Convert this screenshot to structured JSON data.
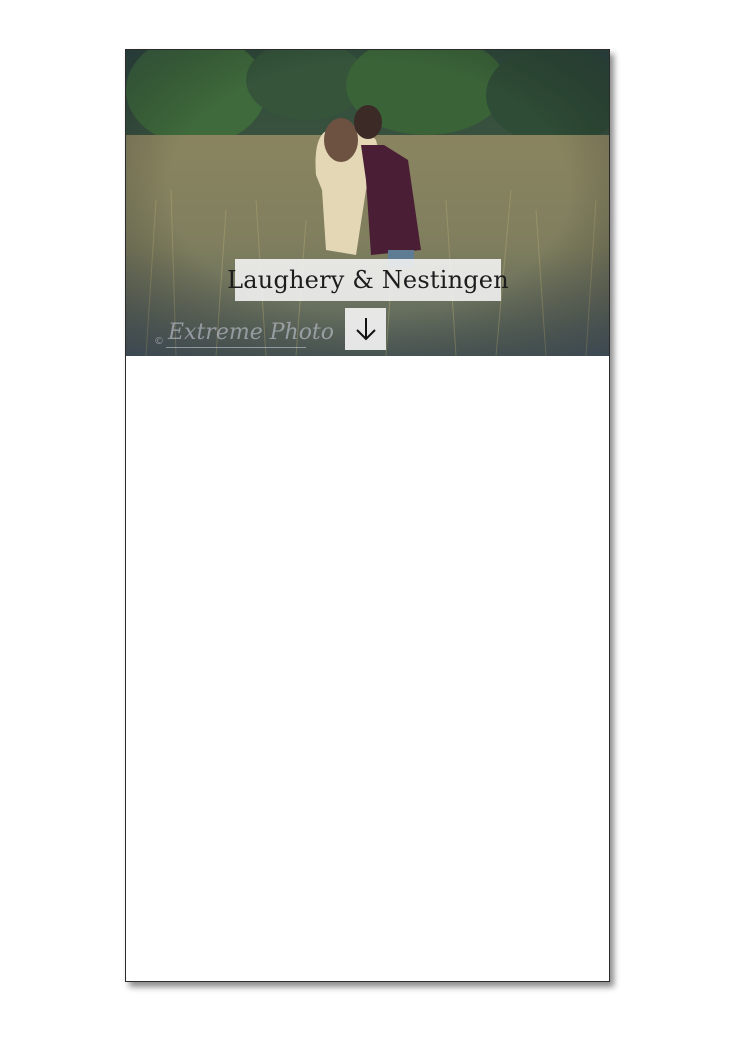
{
  "hero": {
    "title": "Laughery & Nestingen",
    "scroll_icon": "arrow-down-icon",
    "watermark_text": "Extreme Photo",
    "watermark_copyright": "©"
  },
  "colors": {
    "page_border": "#2b2b2b",
    "title_bg": "#f5f5f5",
    "title_text": "#1d1d1d"
  }
}
